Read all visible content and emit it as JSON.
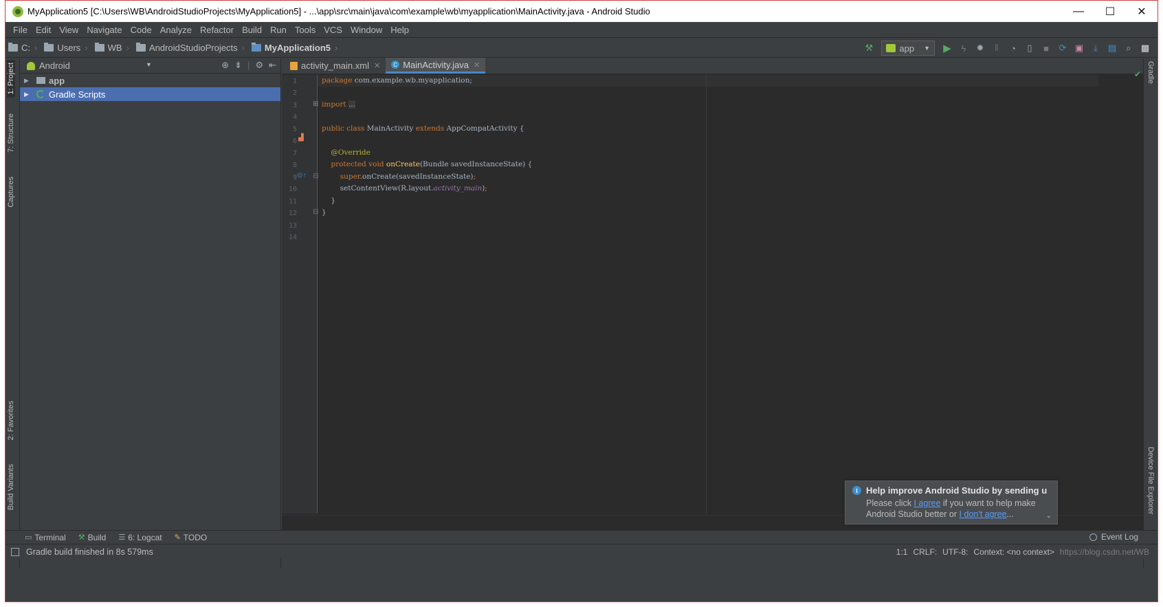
{
  "window": {
    "title": "MyApplication5 [C:\\Users\\WB\\AndroidStudioProjects\\MyApplication5] - ...\\app\\src\\main\\java\\com\\example\\wb\\myapplication\\MainActivity.java - Android Studio",
    "minimize": "—",
    "maximize": "☐",
    "close": "✕"
  },
  "menu": [
    "File",
    "Edit",
    "View",
    "Navigate",
    "Code",
    "Analyze",
    "Refactor",
    "Build",
    "Run",
    "Tools",
    "VCS",
    "Window",
    "Help"
  ],
  "breadcrumbs": [
    "C:",
    "Users",
    "WB",
    "AndroidStudioProjects",
    "MyApplication5"
  ],
  "run_config": "app",
  "left_tool_tabs": [
    "1: Project",
    "7: Structure",
    "Captures",
    "2: Favorites",
    "Build Variants"
  ],
  "right_tool_tabs": [
    "Gradle",
    "Device File Explorer"
  ],
  "project_panel": {
    "view": "Android",
    "tree": [
      {
        "label": "app",
        "bold": true,
        "selected": false
      },
      {
        "label": "Gradle Scripts",
        "bold": false,
        "selected": true
      }
    ]
  },
  "editor": {
    "tabs": [
      {
        "label": "activity_main.xml",
        "type": "xml",
        "active": false
      },
      {
        "label": "MainActivity.java",
        "type": "java",
        "active": true
      }
    ],
    "line_numbers": [
      "1",
      "2",
      "3",
      "4",
      "5",
      "6",
      "7",
      "8",
      "9",
      "10",
      "11",
      "12",
      "13",
      "14"
    ]
  },
  "notification": {
    "title": "Help improve Android Studio by sending u",
    "body_prefix": "Please click ",
    "link_agree": "I agree",
    "body_middle": " if you want to help make Android Studio better or ",
    "link_disagree": "I don't agree",
    "body_suffix": "..."
  },
  "bottom_tools": [
    "Terminal",
    "Build",
    "6: Logcat",
    "TODO"
  ],
  "event_log": "Event Log",
  "status": {
    "message": "Gradle build finished in 8s 579ms",
    "position": "1:1",
    "line_sep": "CRLF:",
    "encoding": "UTF-8:",
    "context": "Context: <no context>",
    "watermark": "https://blog.csdn.net/WB"
  },
  "colors": {
    "bg_dark": "#2b2b2b",
    "panel": "#3c3f41",
    "selection": "#4b6eaf",
    "keyword": "#cc7832",
    "annotation": "#bbb529",
    "method": "#ffc66d",
    "field": "#9876aa",
    "text": "#a9b7c6"
  }
}
